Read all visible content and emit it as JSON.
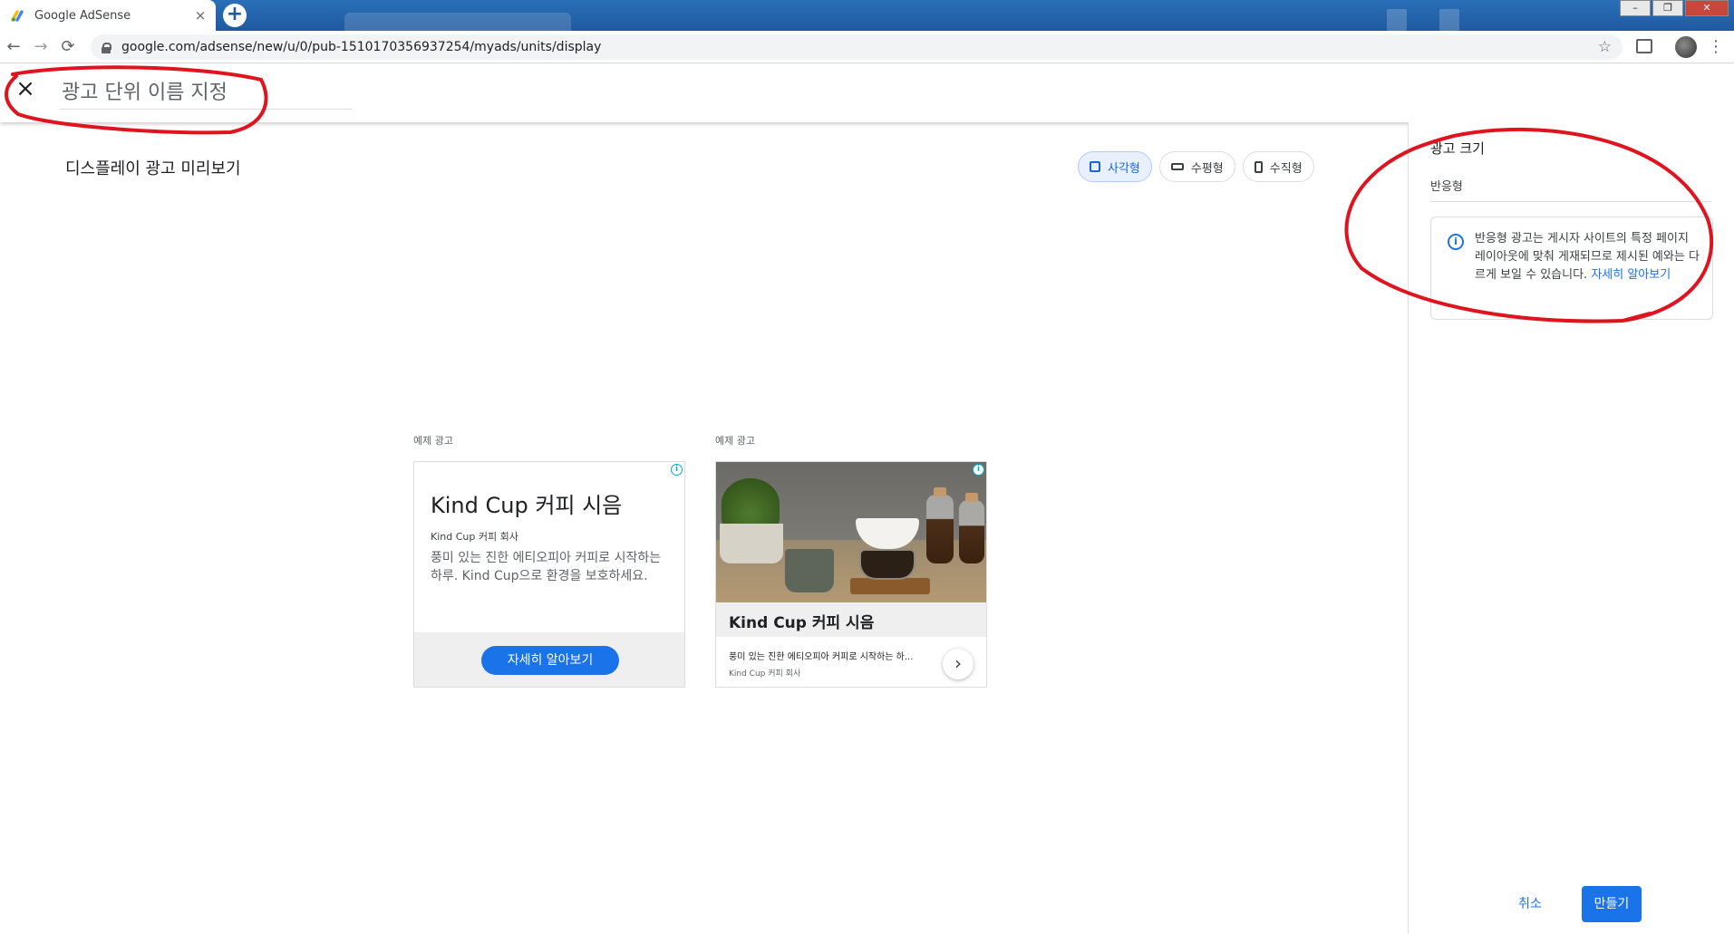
{
  "browser": {
    "tab_title": "Google AdSense",
    "tab_close": "×",
    "new_tab": "+",
    "url": "google.com/adsense/new/u/0/pub-1510170356937254/myads/units/display",
    "back": "←",
    "forward": "→",
    "reload": "⟳",
    "star": "☆",
    "menu": "⋮",
    "window_controls": {
      "minimize": "–",
      "maximize": "❐",
      "close": "✕"
    }
  },
  "header": {
    "close": "×",
    "name_placeholder": "광고 단위 이름 지정"
  },
  "preview": {
    "title": "디스플레이 광고 미리보기",
    "shapes": [
      {
        "label": "사각형",
        "icon": "square-icon",
        "active": true
      },
      {
        "label": "수평형",
        "icon": "horizontal-rect-icon",
        "active": false
      },
      {
        "label": "수직형",
        "icon": "vertical-rect-icon",
        "active": false
      }
    ]
  },
  "ads": [
    {
      "label": "예제 광고",
      "adchoices": "i",
      "headline": "Kind Cup 커피 시음",
      "company": "Kind Cup 커피 회사",
      "description": "풍미 있는 진한 에티오피아 커피로 시작하는 하루. Kind Cup으로 환경을 보호하세요.",
      "cta": "자세히 알아보기"
    },
    {
      "label": "예제 광고",
      "adchoices": "i",
      "headline": "Kind Cup 커피 시음",
      "description": "풍미 있는 진한 에티오피아 커피로 시작하는 하...",
      "company": "Kind Cup 커피 회사",
      "arrow": "›"
    }
  ],
  "side_panel": {
    "title": "광고 크기",
    "size_value": "반응형",
    "info_icon": "i",
    "info_text": "반응형 광고는 게시자 사이트의 특정 페이지 레이아웃에 맞춰 게재되므로 제시된 예와는 다르게 보일 수 있습니다. ",
    "info_link": "자세히 알아보기"
  },
  "actions": {
    "cancel": "취소",
    "create": "만들기"
  },
  "colors": {
    "accent": "#1a73e8",
    "chrome_blue": "#1f5aa0",
    "annotation_red": "#e0141e"
  }
}
